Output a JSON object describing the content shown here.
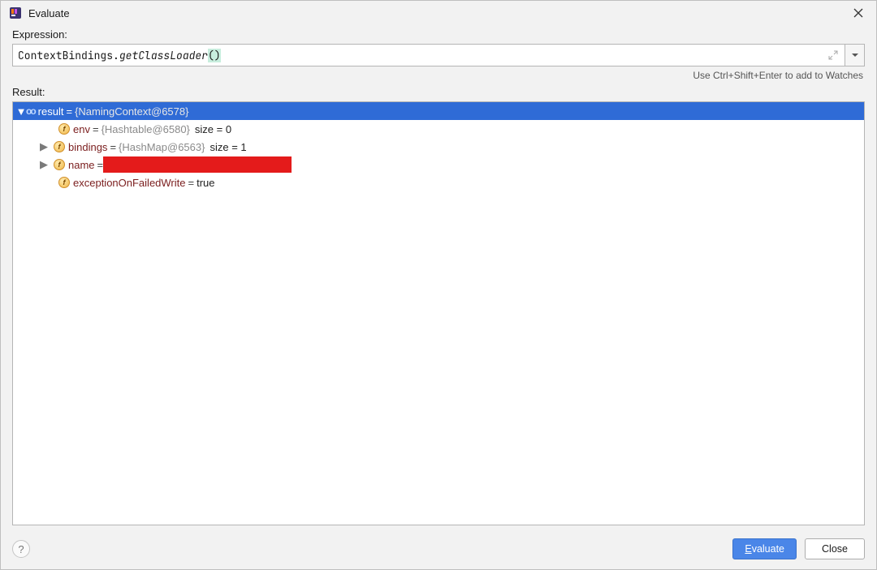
{
  "window": {
    "title": "Evaluate"
  },
  "expression": {
    "label": "Expression:",
    "code_plain": "ContextBindings.",
    "code_method": "getClassLoader",
    "code_parens": "()"
  },
  "hint": "Use Ctrl+Shift+Enter to add to Watches",
  "result": {
    "label": "Result:",
    "root": {
      "name": "result",
      "value": "{NamingContext@6578}"
    },
    "children": [
      {
        "name": "env",
        "value_obj": "{Hashtable@6580}",
        "size": "size = 0",
        "expandable": false
      },
      {
        "name": "bindings",
        "value_obj": "{HashMap@6563}",
        "size": "size = 1",
        "expandable": true
      },
      {
        "name": "name",
        "redacted": true,
        "expandable": true
      },
      {
        "name": "exceptionOnFailedWrite",
        "value_plain": "true",
        "expandable": false
      }
    ]
  },
  "footer": {
    "evaluate": "Evaluate",
    "close": "Close"
  },
  "icons": {
    "chevron_down": "▾",
    "chevron_right": "▸",
    "close_x": "✕",
    "help_q": "?",
    "oo": "oo",
    "f": "f"
  }
}
